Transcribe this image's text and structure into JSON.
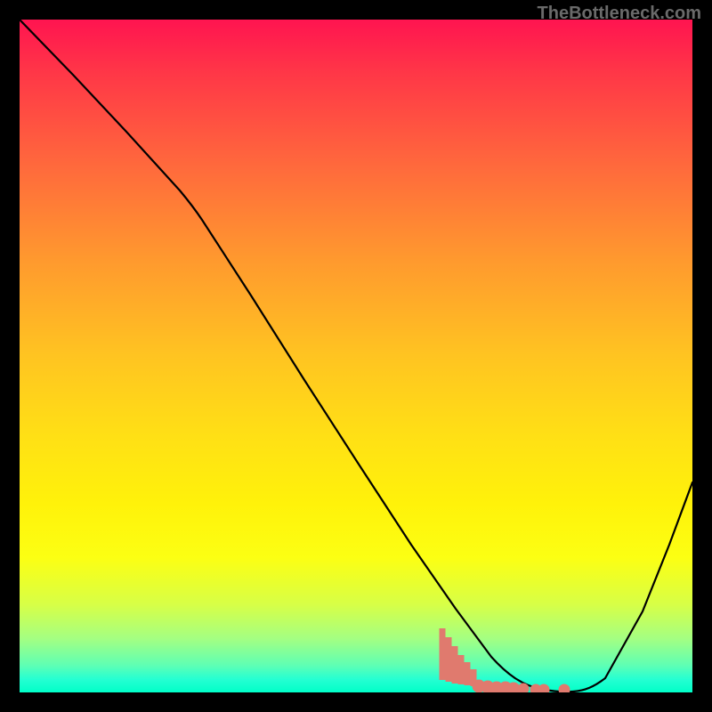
{
  "watermark": {
    "text": "TheBottleneck.com"
  },
  "colors": {
    "curve": "#000000",
    "dots": "#e07a6e"
  },
  "chart_data": {
    "type": "line",
    "title": "",
    "xlabel": "",
    "ylabel": "",
    "xlim": [
      0,
      100
    ],
    "ylim": [
      0,
      100
    ],
    "grid": false,
    "legend": false,
    "series": [
      {
        "name": "curve",
        "x": [
          0,
          6,
          12,
          18,
          24,
          30,
          36,
          42,
          48,
          54,
          60,
          66,
          72,
          78,
          82,
          84,
          88,
          94,
          100
        ],
        "y": [
          100,
          93,
          86,
          79,
          72,
          63,
          53,
          44,
          35,
          26,
          18,
          10,
          4,
          0.5,
          0.3,
          0.4,
          4,
          18,
          35
        ]
      }
    ],
    "annotations": {
      "marker_cluster": {
        "type": "dots",
        "color": "#e07a6e",
        "x_range": [
          60,
          82
        ],
        "y_range": [
          0,
          8
        ]
      }
    }
  }
}
